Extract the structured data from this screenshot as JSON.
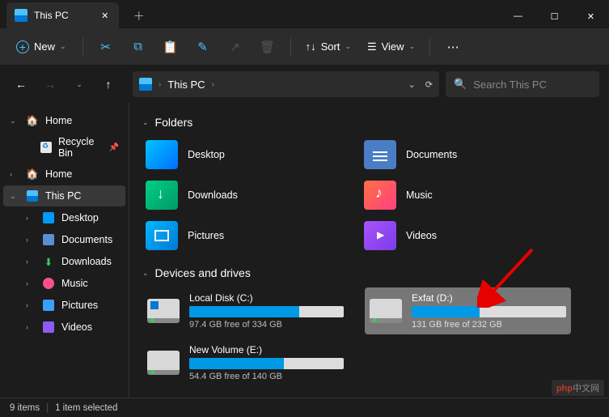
{
  "tab": {
    "title": "This PC"
  },
  "toolbar": {
    "new_label": "New",
    "sort_label": "Sort",
    "view_label": "View"
  },
  "address": {
    "location": "This PC"
  },
  "search": {
    "placeholder": "Search This PC"
  },
  "sidebar": {
    "items": [
      {
        "label": "Home",
        "icon": "home",
        "expandable": true,
        "expanded": true
      },
      {
        "label": "Recycle Bin",
        "icon": "recycle",
        "child": true,
        "pinned": true
      },
      {
        "label": "Home",
        "icon": "home",
        "expandable": true,
        "expanded": false
      },
      {
        "label": "This PC",
        "icon": "pc",
        "expandable": true,
        "expanded": true,
        "selected": true
      },
      {
        "label": "Desktop",
        "icon": "desktop",
        "child": true,
        "expandable": true
      },
      {
        "label": "Documents",
        "icon": "docs",
        "child": true,
        "expandable": true
      },
      {
        "label": "Downloads",
        "icon": "dl",
        "child": true,
        "expandable": true
      },
      {
        "label": "Music",
        "icon": "music",
        "child": true,
        "expandable": true
      },
      {
        "label": "Pictures",
        "icon": "pics",
        "child": true,
        "expandable": true
      },
      {
        "label": "Videos",
        "icon": "vids",
        "child": true,
        "expandable": true
      }
    ]
  },
  "content": {
    "folders_header": "Folders",
    "folders": [
      {
        "label": "Desktop",
        "icon": "desktop"
      },
      {
        "label": "Documents",
        "icon": "docs"
      },
      {
        "label": "Downloads",
        "icon": "dl"
      },
      {
        "label": "Music",
        "icon": "music"
      },
      {
        "label": "Pictures",
        "icon": "pics"
      },
      {
        "label": "Videos",
        "icon": "vids"
      }
    ],
    "drives_header": "Devices and drives",
    "drives": [
      {
        "label": "Local Disk (C:)",
        "free_text": "97.4 GB free of 334 GB",
        "used_pct": 71,
        "win": true,
        "selected": false
      },
      {
        "label": "Exfat (D:)",
        "free_text": "131 GB free of 232 GB",
        "used_pct": 44,
        "win": false,
        "selected": true
      },
      {
        "label": "New Volume (E:)",
        "free_text": "54.4 GB free of 140 GB",
        "used_pct": 61,
        "win": false,
        "selected": false
      }
    ]
  },
  "statusbar": {
    "items": "9 items",
    "selected": "1 item selected"
  },
  "watermark": {
    "brand": "php",
    "text": "中文网"
  },
  "annotation": {
    "arrow_target": "drive-exfat-d"
  }
}
